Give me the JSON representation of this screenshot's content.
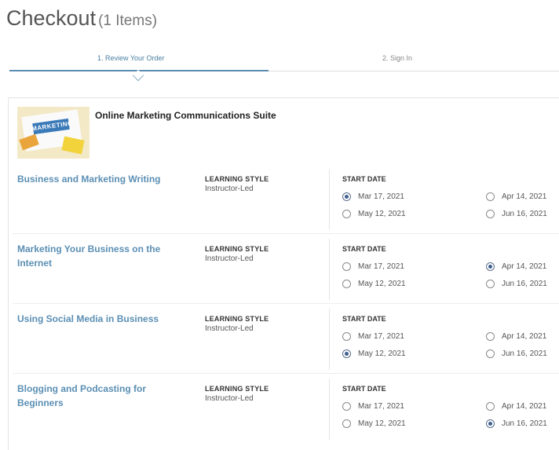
{
  "page": {
    "title": "Checkout",
    "item_count": "(1 Items)"
  },
  "steps": [
    {
      "label": "1. Review Your Order",
      "active": true
    },
    {
      "label": "2. Sign In",
      "active": false
    }
  ],
  "order": {
    "suite_title": "Online Marketing Communications Suite",
    "image_word": "MARKETING",
    "courses": [
      {
        "name": "Business and Marketing Writing",
        "style_label": "LEARNING STYLE",
        "style_value": "Instructor-Led",
        "date_label": "START DATE",
        "dates": [
          "Mar 17, 2021",
          "Apr 14, 2021",
          "May 12, 2021",
          "Jun 16, 2021"
        ],
        "selected": "Mar 17, 2021"
      },
      {
        "name": "Marketing Your Business on the Internet",
        "style_label": "LEARNING STYLE",
        "style_value": "Instructor-Led",
        "date_label": "START DATE",
        "dates": [
          "Mar 17, 2021",
          "Apr 14, 2021",
          "May 12, 2021",
          "Jun 16, 2021"
        ],
        "selected": "Apr 14, 2021"
      },
      {
        "name": "Using Social Media in Business",
        "style_label": "LEARNING STYLE",
        "style_value": "Instructor-Led",
        "date_label": "START DATE",
        "dates": [
          "Mar 17, 2021",
          "Apr 14, 2021",
          "May 12, 2021",
          "Jun 16, 2021"
        ],
        "selected": "May 12, 2021"
      },
      {
        "name": "Blogging and Podcasting for Beginners",
        "style_label": "LEARNING STYLE",
        "style_value": "Instructor-Led",
        "date_label": "START DATE",
        "dates": [
          "Mar 17, 2021",
          "Apr 14, 2021",
          "May 12, 2021",
          "Jun 16, 2021"
        ],
        "selected": "Jun 16, 2021"
      }
    ]
  },
  "colors": {
    "accent": "#5b8fb4",
    "radio_selected": "#3f5f8f"
  }
}
